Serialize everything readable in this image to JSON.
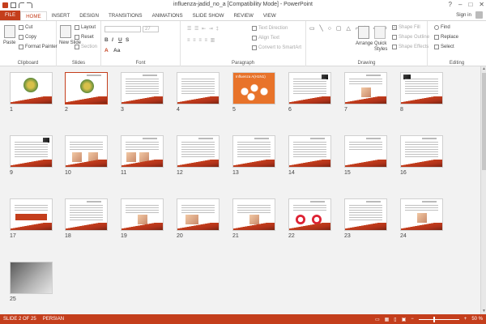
{
  "window": {
    "title": "influenza-jadid_no_a [Compatibility Mode] - PowerPoint",
    "controls": [
      "?",
      "–",
      "□",
      "✕"
    ]
  },
  "tabs": [
    "FILE",
    "HOME",
    "INSERT",
    "DESIGN",
    "TRANSITIONS",
    "ANIMATIONS",
    "SLIDE SHOW",
    "REVIEW",
    "VIEW"
  ],
  "account": {
    "signin": "Sign in"
  },
  "ribbon": {
    "clipboard": {
      "label": "Clipboard",
      "paste": "Paste",
      "cut": "Cut",
      "copy": "Copy",
      "format_painter": "Format Painter"
    },
    "slides": {
      "label": "Slides",
      "new_slide": "New Slide",
      "layout": "Layout",
      "reset": "Reset",
      "section": "Section"
    },
    "font": {
      "label": "Font",
      "size": "27"
    },
    "paragraph": {
      "label": "Paragraph",
      "text_direction": "Text Direction",
      "align_text": "Align Text",
      "convert_smartart": "Convert to SmartArt"
    },
    "drawing": {
      "label": "Drawing",
      "arrange": "Arrange",
      "quick_styles": "Quick Styles",
      "shape_fill": "Shape Fill",
      "shape_outline": "Shape Outline",
      "shape_effects": "Shape Effects"
    },
    "editing": {
      "label": "Editing",
      "find": "Find",
      "replace": "Replace",
      "select": "Select"
    }
  },
  "slides": [
    {
      "num": "1"
    },
    {
      "num": "2"
    },
    {
      "num": "3"
    },
    {
      "num": "4"
    },
    {
      "num": "5",
      "title": "Influenza A(H1N1)"
    },
    {
      "num": "6"
    },
    {
      "num": "7"
    },
    {
      "num": "8"
    },
    {
      "num": "9"
    },
    {
      "num": "10"
    },
    {
      "num": "11"
    },
    {
      "num": "12"
    },
    {
      "num": "13"
    },
    {
      "num": "14"
    },
    {
      "num": "15"
    },
    {
      "num": "16"
    },
    {
      "num": "17"
    },
    {
      "num": "18"
    },
    {
      "num": "19"
    },
    {
      "num": "20"
    },
    {
      "num": "21"
    },
    {
      "num": "22"
    },
    {
      "num": "23"
    },
    {
      "num": "24"
    },
    {
      "num": "25"
    }
  ],
  "selected_slide": "2",
  "status": {
    "slide": "SLIDE 2 OF 25",
    "language": "PERSIAN",
    "zoom": "50 %",
    "zoom_minus": "−",
    "zoom_plus": "+"
  },
  "colors": {
    "accent": "#c43e1c"
  }
}
